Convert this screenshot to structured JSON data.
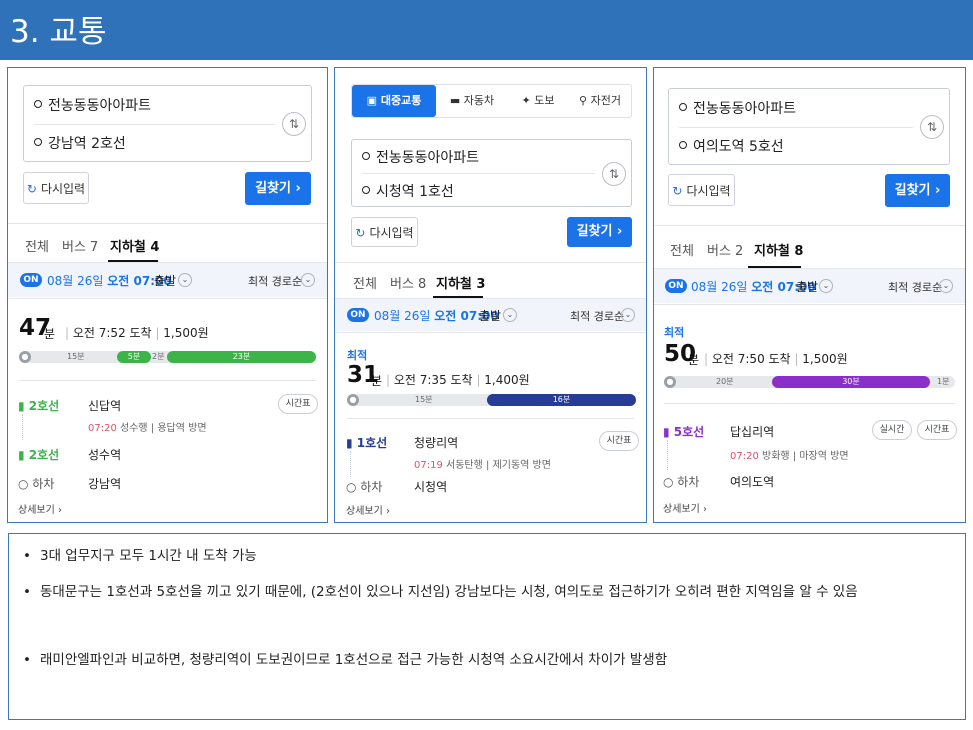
{
  "slide_title": "3. 교통",
  "panels": [
    {
      "origin": "전농동동아아파트",
      "destination": "강남역 2호선",
      "reset_label": "다시입력",
      "find_label": "길찾기 ›",
      "tabs": [
        "전체",
        "버스 7",
        "지하철 4"
      ],
      "date": "08월 26일",
      "time": "오전 07:00",
      "depart": "출발",
      "sort": "최적 경로순",
      "best": "",
      "duration_num": "47",
      "duration_unit": "분",
      "arrival": "오전 7:52 도착",
      "fare": "1,500원",
      "bar": {
        "walk1": "15분",
        "s1": "5분",
        "walk2": "2분",
        "s2": "23분"
      },
      "steps": [
        {
          "line": "2호선",
          "station": "신답역",
          "time": "07:20",
          "dir1": "성수행",
          "dir2": "용답역 방면",
          "pill": "시간표"
        },
        {
          "line": "2호선",
          "station": "성수역"
        },
        {
          "line": "하차",
          "station": "강남역"
        }
      ],
      "detail": "상세보기 ›"
    },
    {
      "modes": [
        "대중교통",
        "자동차",
        "도보",
        "자전거"
      ],
      "origin": "전농동동아아파트",
      "destination": "시청역 1호선",
      "reset_label": "다시입력",
      "find_label": "길찾기 ›",
      "tabs": [
        "전체",
        "버스 8",
        "지하철 3"
      ],
      "date": "08월 26일",
      "time": "오전 07:00",
      "depart": "출발",
      "sort": "최적 경로순",
      "best": "최적",
      "duration_num": "31",
      "duration_unit": "분",
      "arrival": "오전 7:35 도착",
      "fare": "1,400원",
      "bar": {
        "walk1": "15분",
        "s1": "16분"
      },
      "steps": [
        {
          "line": "1호선",
          "station": "청량리역",
          "time": "07:19",
          "dir1": "서동탄행",
          "dir2": "제기동역 방면",
          "pill": "시간표"
        },
        {
          "line": "하차",
          "station": "시청역"
        }
      ],
      "detail": "상세보기 ›"
    },
    {
      "origin": "전농동동아아파트",
      "destination": "여의도역 5호선",
      "reset_label": "다시입력",
      "find_label": "길찾기 ›",
      "tabs": [
        "전체",
        "버스 2",
        "지하철 8"
      ],
      "date": "08월 26일",
      "time": "오전 07:00",
      "depart": "출발",
      "sort": "최적 경로순",
      "best": "최적",
      "duration_num": "50",
      "duration_unit": "분",
      "arrival": "오전 7:50 도착",
      "fare": "1,500원",
      "bar": {
        "walk1": "20분",
        "s1": "30분",
        "walk2": "1분"
      },
      "steps": [
        {
          "line": "5호선",
          "station": "답십리역",
          "time": "07:20",
          "dir1": "방화행",
          "dir2": "마장역 방면",
          "pill": "시간표",
          "pill2": "실시간"
        },
        {
          "line": "하차",
          "station": "여의도역"
        }
      ],
      "detail": "상세보기 ›"
    }
  ],
  "notes": [
    "3대 업무지구 모두 1시간 내 도착 가능",
    "동대문구는 1호선과 5호선을 끼고 있기 때문에, (2호선이 있으나 지선임) 강남보다는 시청, 여의도로 접근하기가 오히려 편한 지역임을 알 수 있음",
    "래미안엘파인과 비교하면, 청량리역이 도보권이므로 1호선으로 접근 가능한 시청역 소요시간에서 차이가 발생함"
  ],
  "colors": {
    "header": "#2f72b9",
    "line2": "#3cb44a",
    "line1": "#263c96",
    "line5": "#8b2fc9",
    "accent": "#1a73e8"
  }
}
